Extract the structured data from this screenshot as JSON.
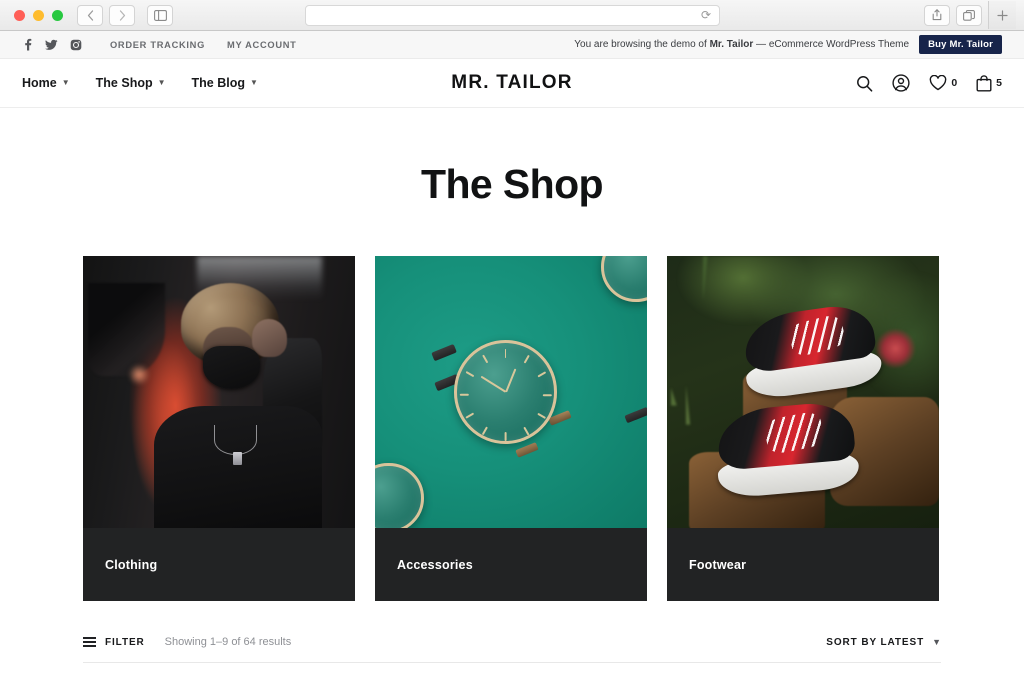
{
  "browser": {
    "url_value": "",
    "url_placeholder": "",
    "back_icon": "chevron-left-icon",
    "forward_icon": "chevron-right-icon",
    "sidebar_icon": "sidebar-icon",
    "reload_icon": "reload-icon",
    "share_icon": "share-icon",
    "tabs_icon": "tabs-overview-icon",
    "new_tab_icon": "plus-icon"
  },
  "topbar": {
    "social": [
      {
        "name": "facebook-icon",
        "label": "f"
      },
      {
        "name": "twitter-icon",
        "label": "t"
      },
      {
        "name": "instagram-icon",
        "label": "ig"
      }
    ],
    "links": [
      {
        "label": "ORDER TRACKING"
      },
      {
        "label": "MY ACCOUNT"
      }
    ],
    "demo_prefix": "You are browsing the demo of ",
    "demo_brand": "Mr. Tailor",
    "demo_suffix": " — eCommerce WordPress Theme",
    "buy_label": "Buy Mr. Tailor",
    "buy_color": "#17244a"
  },
  "header": {
    "nav": [
      {
        "label": "Home",
        "has_dropdown": true
      },
      {
        "label": "The Shop",
        "has_dropdown": true
      },
      {
        "label": "The Blog",
        "has_dropdown": true
      }
    ],
    "logo": "MR. TAILOR",
    "actions": {
      "search_icon": "search-icon",
      "account_icon": "account-icon",
      "wishlist_icon": "heart-icon",
      "wishlist_count": "0",
      "cart_icon": "shopping-bag-icon",
      "cart_count": "5"
    }
  },
  "main": {
    "page_title": "The Shop",
    "categories": [
      {
        "label": "Clothing",
        "photo": "urban-portrait-photo"
      },
      {
        "label": "Accessories",
        "photo": "watches-on-teal-photo"
      },
      {
        "label": "Footwear",
        "photo": "red-black-sneakers-photo"
      }
    ],
    "toolbar": {
      "filter_icon": "filter-hamburger-icon",
      "filter_label": "FILTER",
      "results_text": "Showing 1–9 of 64 results",
      "sort_label": "SORT BY LATEST",
      "sort_caret_icon": "chevron-down-icon"
    }
  }
}
